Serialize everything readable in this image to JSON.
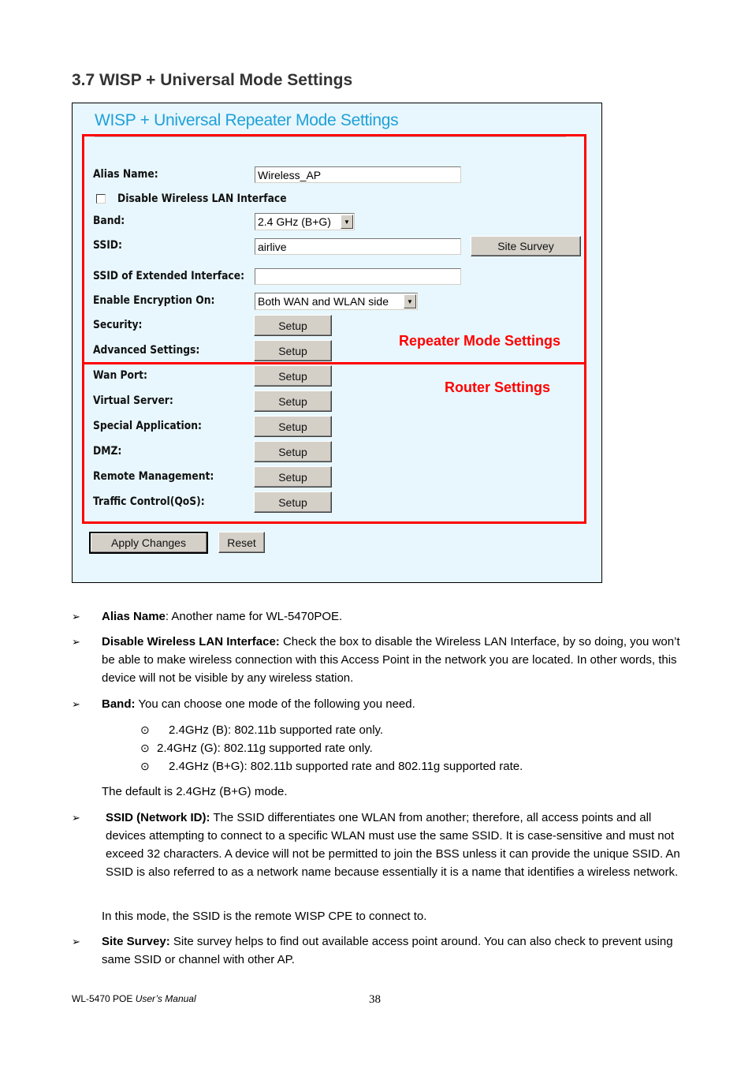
{
  "section_title": "3.7 WISP + Universal Mode Settings",
  "screenshot": {
    "panel_title": "WISP + Universal Repeater Mode Settings",
    "annotations": {
      "repeater": "Repeater Mode Settings",
      "router": "Router Settings"
    },
    "form": {
      "alias_name": {
        "label": "Alias Name:",
        "value": "Wireless_AP"
      },
      "disable_wlan": {
        "label": "Disable Wireless LAN Interface",
        "checked": false
      },
      "band": {
        "label": "Band:",
        "selected": "2.4 GHz (B+G)"
      },
      "ssid": {
        "label": "SSID:",
        "value": "airlive",
        "site_survey_label": "Site Survey"
      },
      "ssid_extended": {
        "label": "SSID of Extended Interface:",
        "value": ""
      },
      "encryption": {
        "label": "Enable Encryption On:",
        "selected": "Both WAN and WLAN side"
      },
      "security": {
        "label": "Security:",
        "button": "Setup"
      },
      "advanced": {
        "label": "Advanced Settings:",
        "button": "Setup"
      }
    },
    "router": [
      {
        "label": "Wan Port:",
        "button": "Setup"
      },
      {
        "label": "Virtual Server:",
        "button": "Setup"
      },
      {
        "label": "Special Application:",
        "button": "Setup"
      },
      {
        "label": "DMZ:",
        "button": "Setup"
      },
      {
        "label": "Remote Management:",
        "button": "Setup"
      },
      {
        "label": "Traffic Control(QoS):",
        "button": "Setup"
      }
    ],
    "apply_label": "Apply Changes",
    "reset_label": "Reset"
  },
  "bullet_mark": "➢",
  "sub_mark": "⊙",
  "bullets": {
    "alias": {
      "term": "Alias Name",
      "text": ": Another name for WL-5470POE."
    },
    "disable": {
      "term": "Disable Wireless LAN Interface:",
      "text": " Check the box to disable the Wireless LAN Interface, by so doing, you won’t be able to make wireless connection with this Access Point in the network you are located. In other words, this device will not be visible by any wireless station."
    },
    "band": {
      "term": "Band:",
      "text": " You can choose one mode of the following you need.",
      "options": [
        "2.4GHz (B): 802.11b supported rate only.",
        "2.4GHz (G): 802.11g supported rate only.",
        "2.4GHz (B+G): 802.11b supported rate and 802.11g supported rate."
      ],
      "default_note": "The default is 2.4GHz (B+G) mode."
    },
    "ssid": {
      "term": "SSID (Network ID):",
      "text": " The SSID differentiates one WLAN from another; therefore, all access points and all devices attempting to connect to a specific WLAN must use the same SSID. It is case-sensitive and must not exceed 32 characters. A device will not be permitted to join the BSS unless it can provide the unique SSID. An SSID is also referred to as a network name because essentially it is a name that identifies a wireless network.",
      "mode_note": "In this mode, the SSID is the remote WISP CPE to connect to."
    },
    "site_survey": {
      "term": "Site Survey:",
      "text": " Site survey helps to find out available access point around. You can also check to prevent using same SSID or channel with other AP."
    }
  },
  "footer": {
    "product": "WL-5470 POE ",
    "manual": "User’s Manual",
    "page": "38"
  }
}
